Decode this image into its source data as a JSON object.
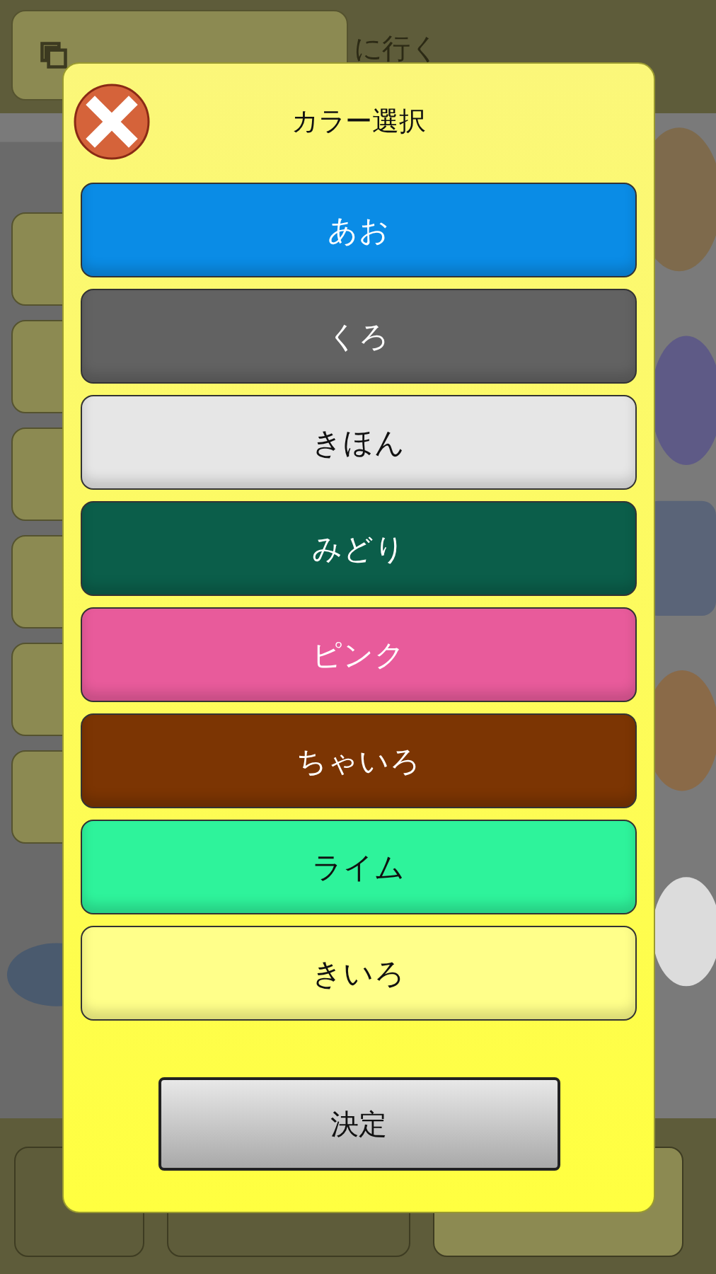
{
  "background": {
    "top_link": "に行く"
  },
  "dialog": {
    "title": "カラー選択",
    "options": [
      {
        "label": "あお",
        "color": "#0a8ce6"
      },
      {
        "label": "くろ",
        "color": "#626262"
      },
      {
        "label": "きほん",
        "color": "#e6e6e6"
      },
      {
        "label": "みどり",
        "color": "#0b5e4a"
      },
      {
        "label": "ピンク",
        "color": "#e85b9b"
      },
      {
        "label": "ちゃいろ",
        "color": "#7c3503"
      },
      {
        "label": "ライム",
        "color": "#2ef39b"
      },
      {
        "label": "きいろ",
        "color": "#ffff8a"
      }
    ],
    "confirm": "決定"
  }
}
